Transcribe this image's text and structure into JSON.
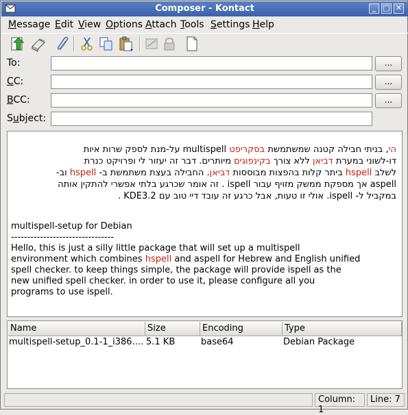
{
  "window": {
    "title": "Composer - Kontact"
  },
  "menu": [
    {
      "label": "Message",
      "accel": "M",
      "rest": "essage"
    },
    {
      "label": "Edit",
      "accel": "E",
      "rest": "dit"
    },
    {
      "label": "View",
      "accel": "V",
      "rest": "iew"
    },
    {
      "label": "Options",
      "accel": "O",
      "rest": "ptions"
    },
    {
      "label": "Attach",
      "accel": "A",
      "rest": "ttach"
    },
    {
      "label": "Tools",
      "accel": "T",
      "rest": "ools"
    },
    {
      "label": "Settings",
      "accel": "S",
      "rest": "ettings"
    },
    {
      "label": "Help",
      "accel": "H",
      "rest": "elp"
    }
  ],
  "toolbar_icons": [
    "send-now-icon",
    "send-later-icon",
    "attach-file-icon",
    "cut-icon",
    "copy-icon",
    "paste-icon",
    "sign-icon",
    "encrypt-icon",
    "new-document-icon"
  ],
  "fields": {
    "to": {
      "label": "To:",
      "value": ""
    },
    "cc": {
      "accel": "C",
      "rest": "C:",
      "value": ""
    },
    "bcc": {
      "accel": "B",
      "rest": "CC:",
      "value": ""
    },
    "subject": {
      "pre": "S",
      "accel": "u",
      "rest": "bject:",
      "value": ""
    },
    "browse_label": "..."
  },
  "body": {
    "hebrew": {
      "l1": {
        "a": "הי",
        "b": ", בניתי חבילה קטנה שמשתמשת ",
        "c": "בסקריפט",
        "d": " multispell  על-מנת לספק שרות איות"
      },
      "l2": {
        "a": "דו-לשוני במערת ",
        "b": "דביאן",
        "c": " ללא צורך ",
        "d": "בקינפוגים",
        "e": " מיותרים. דבר זה יעזור לי ופרויקט כנרת"
      },
      "l3": {
        "a": "לשלב ",
        "b": "hspell",
        "c": " ביתר קלות בהפצות מבוססות ",
        "d": "דביאן",
        "e": ". החבילה בעצת משתמשת ב- ",
        "f": "hspell",
        "g": " וב-"
      },
      "l4": "aspell אך מספקת ממשק מזויף עבור ispell . זה אומר שכרגע בלתי אפשרי להתקין אותה",
      "l5": "במקביל ל- ispell. אולי זו טעות, אבל כרגע זה עובד דיי טוב עם KDE3.2 ."
    },
    "english": {
      "heading": "multispell-setup for Debian",
      "rule": "--------------------------------",
      "p1": "Hello, this is just a silly little package that will set up a multispell",
      "p2a": "environment which combines ",
      "p2b": "hspell",
      "p2c": " and aspell for Hebrew and English unified",
      "p3": "spell checker. to keep things simple, the package will provide ispell as the",
      "p4": "new unified spell checker. in order to use it, please configure all you",
      "p5": "programs to use ispell."
    }
  },
  "attachments": {
    "columns": [
      "Name",
      "Size",
      "Encoding",
      "Type"
    ],
    "rows": [
      {
        "name": "multispell-setup_0.1-1_i386....",
        "size": "5.1 KB",
        "encoding": "base64",
        "type": "Debian Package"
      }
    ]
  },
  "status": {
    "column": "Column: 1",
    "line": "Line: 7"
  },
  "colors": {
    "titlebar": "#3a62ac",
    "highlight_red": "#c4200c"
  }
}
